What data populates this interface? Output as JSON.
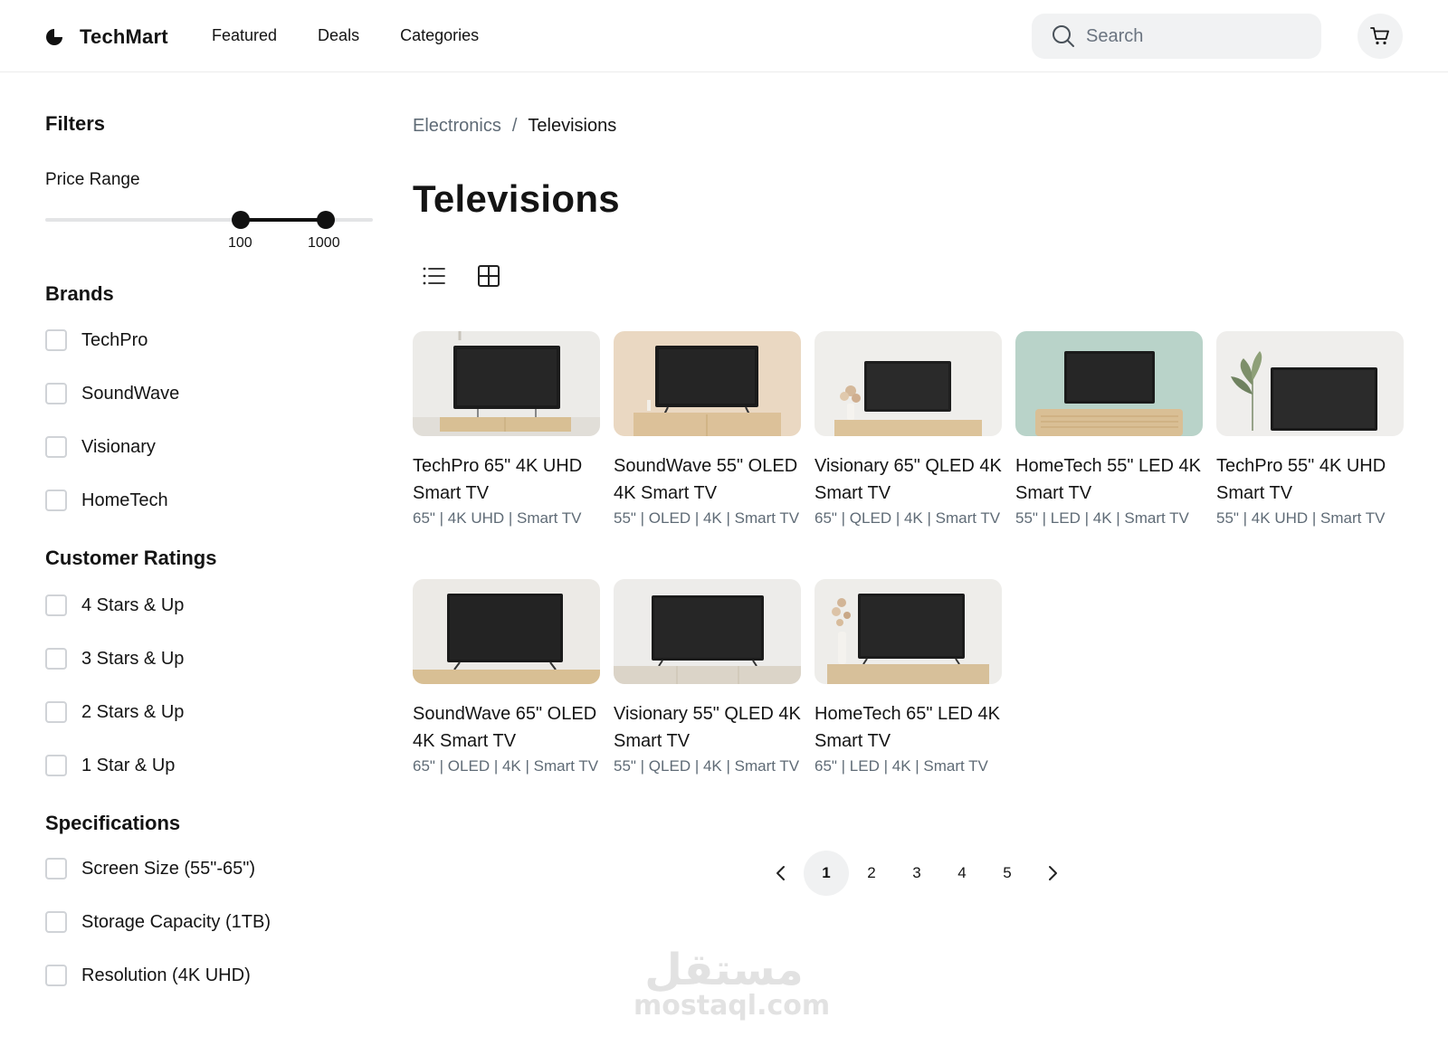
{
  "header": {
    "brand": "TechMart",
    "nav": [
      "Featured",
      "Deals",
      "Categories"
    ],
    "search_placeholder": "Search"
  },
  "sidebar": {
    "title": "Filters",
    "price": {
      "label": "Price Range",
      "min": "100",
      "max": "1000"
    },
    "brands": {
      "title": "Brands",
      "items": [
        "TechPro",
        "SoundWave",
        "Visionary",
        "HomeTech"
      ]
    },
    "ratings": {
      "title": "Customer Ratings",
      "items": [
        "4 Stars & Up",
        "3 Stars & Up",
        "2 Stars & Up",
        "1 Star & Up"
      ]
    },
    "specs": {
      "title": "Specifications",
      "items": [
        "Screen Size (55\"-65\")",
        "Storage Capacity (1TB)",
        "Resolution (4K UHD)"
      ]
    }
  },
  "breadcrumb": {
    "parent": "Electronics",
    "separator": "/",
    "current": "Televisions"
  },
  "page_title": "Televisions",
  "products": [
    {
      "name": "TechPro 65\" 4K UHD Smart TV",
      "specs": "65\" | 4K UHD | Smart TV"
    },
    {
      "name": "SoundWave 55\" OLED 4K Smart TV",
      "specs": "55\" | OLED | 4K | Smart TV"
    },
    {
      "name": "Visionary 65\" QLED 4K Smart TV",
      "specs": "65\" | QLED | 4K | Smart TV"
    },
    {
      "name": "HomeTech 55\" LED 4K Smart TV",
      "specs": "55\" | LED | 4K | Smart TV"
    },
    {
      "name": "TechPro 55\" 4K UHD Smart TV",
      "specs": "55\" | 4K UHD | Smart TV"
    },
    {
      "name": "SoundWave 65\" OLED 4K Smart TV",
      "specs": "65\" | OLED | 4K | Smart TV"
    },
    {
      "name": "Visionary 55\" QLED 4K Smart TV",
      "specs": "55\" | QLED | 4K | Smart TV"
    },
    {
      "name": "HomeTech 65\" LED 4K Smart TV",
      "specs": "65\" | LED | 4K | Smart TV"
    }
  ],
  "pagination": {
    "pages": [
      "1",
      "2",
      "3",
      "4",
      "5"
    ],
    "current": "1"
  },
  "watermark": {
    "arabic": "مستقل",
    "latin": "mostaql.com"
  }
}
